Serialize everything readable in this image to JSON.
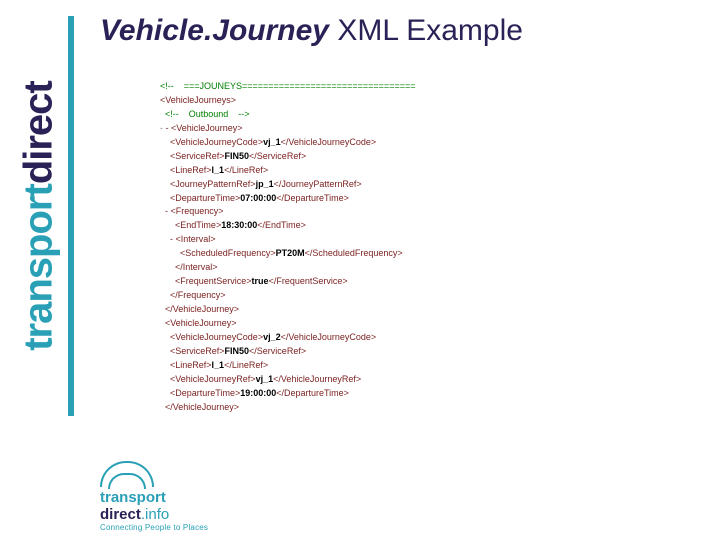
{
  "sidebar": {
    "word1": "transport",
    "word2": "direct"
  },
  "title": {
    "ital": "Vehicle.Journey",
    "rest": " XML Example"
  },
  "code": {
    "l01": "<!--    ===JOUNEYS=================================",
    "l02": "<VehicleJourneys>",
    "l03": "  <!--    Outbound    -->",
    "l04": "- <VehicleJourney>",
    "l05a": "    <VehicleJourneyCode>",
    "l05b": "vj_1",
    "l05c": "</VehicleJourneyCode>",
    "l06a": "    <ServiceRef>",
    "l06b": "FIN50",
    "l06c": "</ServiceRef>",
    "l07a": "    <LineRef>",
    "l07b": "l_1",
    "l07c": "</LineRef>",
    "l08a": "    <JourneyPatternRef>",
    "l08b": "jp_1",
    "l08c": "</JourneyPatternRef>",
    "l09a": "    <DepartureTime>",
    "l09b": "07:00:00",
    "l09c": "</DepartureTime>",
    "l10": "  - <Frequency>",
    "l11a": "      <EndTime>",
    "l11b": "18:30:00",
    "l11c": "</EndTime>",
    "l12": "    - <Interval>",
    "l13a": "        <ScheduledFrequency>",
    "l13b": "PT20M",
    "l13c": "</ScheduledFrequency>",
    "l14": "      </Interval>",
    "l15a": "      <FrequentService>",
    "l15b": "true",
    "l15c": "</FrequentService>",
    "l16": "    </Frequency>",
    "l17": "  </VehicleJourney>",
    "l18": "  <VehicleJourney>",
    "l19a": "    <VehicleJourneyCode>",
    "l19b": "vj_2",
    "l19c": "</VehicleJourneyCode>",
    "l20a": "    <ServiceRef>",
    "l20b": "FIN50",
    "l20c": "</ServiceRef>",
    "l21a": "    <LineRef>",
    "l21b": "l_1",
    "l21c": "</LineRef>",
    "l22a": "    <VehicleJourneyRef>",
    "l22b": "vj_1",
    "l22c": "</VehicleJourneyRef>",
    "l23a": "    <DepartureTime>",
    "l23b": "19:00:00",
    "l23c": "</DepartureTime>",
    "l24": "  </VehicleJourney>"
  },
  "footer": {
    "word1": "transport",
    "word2": "direct",
    "suffix": ".info",
    "tagline": "Connecting People to Places"
  }
}
